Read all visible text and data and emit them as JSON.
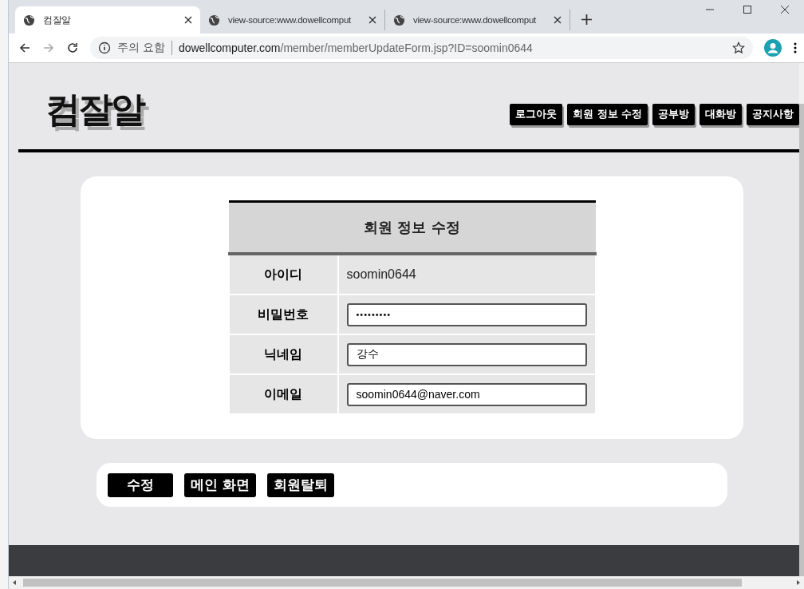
{
  "browser": {
    "tabs": [
      {
        "title": "컴잘알",
        "selected": true
      },
      {
        "title": "view-source:www.dowellcomput",
        "selected": false
      },
      {
        "title": "view-source:www.dowellcomput",
        "selected": false
      }
    ],
    "security": "주의 요함",
    "url_host": "dowellcomputer.com",
    "url_path": "/member/memberUpdateForm.jsp?ID=soomin0644"
  },
  "page": {
    "logo": "컴잘알",
    "nav": [
      "로그아웃",
      "회원 정보 수정",
      "공부방",
      "대화방",
      "공지사항"
    ],
    "form": {
      "title": "회원 정보 수정",
      "rows": [
        {
          "label": "아이디",
          "kind": "text",
          "value": "soomin0644"
        },
        {
          "label": "비밀번호",
          "kind": "password",
          "value": "•••••••••"
        },
        {
          "label": "닉네임",
          "kind": "input",
          "value": "강수"
        },
        {
          "label": "이메일",
          "kind": "input",
          "value": "soomin0644@naver.com"
        }
      ]
    },
    "buttons": [
      "수정",
      "메인 화면",
      "회원탈퇴"
    ]
  }
}
